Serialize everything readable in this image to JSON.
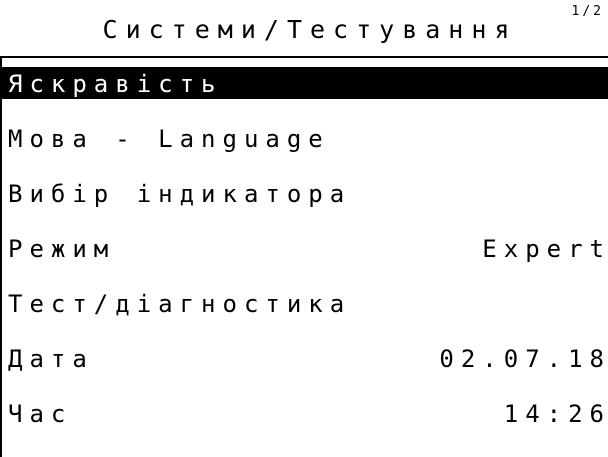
{
  "header": {
    "title": "Системи/Тестування",
    "page_indicator": "1/2"
  },
  "menu": {
    "items": [
      {
        "label": "Яскравість",
        "value": "",
        "selected": true
      },
      {
        "label": "Мова - Language",
        "value": "",
        "selected": false
      },
      {
        "label": "Вибір індикатора",
        "value": "",
        "selected": false
      },
      {
        "label": "Режим",
        "value": "Expert",
        "selected": false
      },
      {
        "label": "Тест/діагностика",
        "value": "",
        "selected": false
      },
      {
        "label": "Дата",
        "value": "02.07.18",
        "selected": false
      },
      {
        "label": "Час",
        "value": "14:26",
        "selected": false
      }
    ]
  },
  "colors": {
    "background": "#ffffff",
    "foreground": "#000000",
    "selection": "#000000",
    "selection_text": "#ffffff"
  }
}
